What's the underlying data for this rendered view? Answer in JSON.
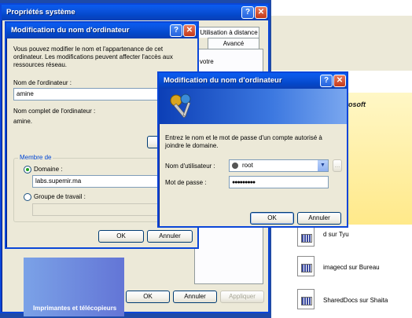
{
  "colors": {
    "accent": "#0a46d8",
    "titlebar": "#0447c8",
    "background": "#1e4aa8",
    "dialog": "#ece9d8"
  },
  "sysprops": {
    "title": "Propriétés système",
    "tabs": [
      "Utilisation à distance",
      "Avancé"
    ],
    "partial_text": "r votre",
    "buttons": {
      "ok": "OK",
      "cancel": "Annuler",
      "apply": "Appliquer"
    },
    "bottom_text": "Imprimantes et télécopieurs"
  },
  "rename": {
    "title": "Modification du nom d'ordinateur",
    "intro": [
      "Vous pouvez modifier le nom et l'appartenance de cet",
      "ordinateur. Les modifications peuvent affecter l'accès aux",
      "ressources réseau."
    ],
    "computer_name_label": "Nom de l'ordinateur :",
    "computer_name_value": "amine",
    "full_name_label": "Nom complet de l'ordinateur :",
    "full_name_value": "amine.",
    "member_of_label": "Membre de",
    "domain_label": "Domaine :",
    "domain_value": "labs.supemir.ma",
    "workgroup_label": "Groupe de travail :",
    "ok": "OK",
    "cancel": "Annuler"
  },
  "auth": {
    "title": "Modification du nom d'ordinateur",
    "message": [
      "Entrez le nom et le mot de passe d'un compte autorisé à",
      "joindre le domaine."
    ],
    "username_label": "Nom d'utilisateur :",
    "username_value": "root",
    "password_label": "Mot de passe :",
    "password_value": "●●●●●●●●●",
    "ok": "OK",
    "cancel": "Annuler",
    "browse": "..."
  },
  "explorer": {
    "logo_text": "icrosoft",
    "files": [
      "d sur Tyu",
      "imagecd sur Bureau",
      "SharedDocs sur Shaita"
    ]
  }
}
